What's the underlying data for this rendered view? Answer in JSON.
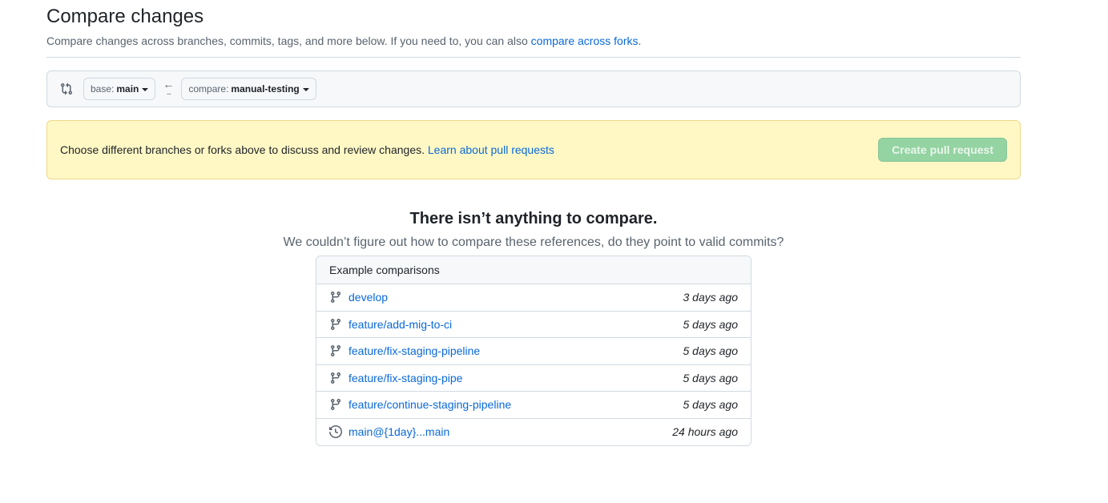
{
  "header": {
    "title": "Compare changes",
    "subtitle_prefix": "Compare changes across branches, commits, tags, and more below. If you need to, you can also ",
    "subtitle_link": "compare across forks",
    "subtitle_suffix": "."
  },
  "range": {
    "base_label": "base:",
    "base_value": "main",
    "compare_label": "compare:",
    "compare_value": "manual-testing",
    "arrow": "←",
    "dots": "..."
  },
  "flash": {
    "message": "Choose different branches or forks above to discuss and review changes. ",
    "link": "Learn about pull requests",
    "button": "Create pull request"
  },
  "blankslate": {
    "heading": "There isn’t anything to compare.",
    "text": "We couldn’t figure out how to compare these references, do they point to valid commits?"
  },
  "examples": {
    "header": "Example comparisons",
    "rows": [
      {
        "icon": "git-branch-icon",
        "name": "develop",
        "time": "3 days ago"
      },
      {
        "icon": "git-branch-icon",
        "name": "feature/add-mig-to-ci",
        "time": "5 days ago"
      },
      {
        "icon": "git-branch-icon",
        "name": "feature/fix-staging-pipeline",
        "time": "5 days ago"
      },
      {
        "icon": "git-branch-icon",
        "name": "feature/fix-staging-pipe",
        "time": "5 days ago"
      },
      {
        "icon": "git-branch-icon",
        "name": "feature/continue-staging-pipeline",
        "time": "5 days ago"
      },
      {
        "icon": "history-icon",
        "name": "main@{1day}...main",
        "time": "24 hours ago"
      }
    ]
  },
  "colors": {
    "link": "#0969da",
    "flash_bg": "#fff8c5",
    "button_disabled": "#94d3a2"
  }
}
